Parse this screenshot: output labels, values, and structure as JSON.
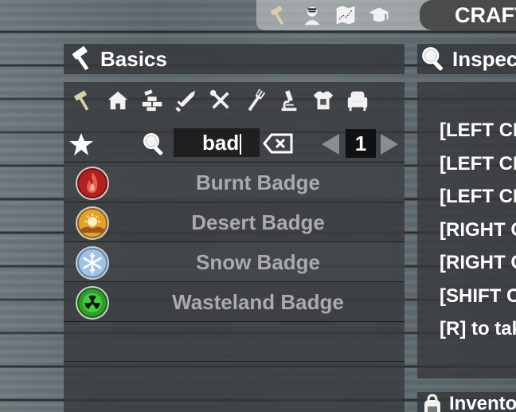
{
  "top_bar": {
    "icons": [
      "hammer-icon",
      "survivor-icon",
      "map-icon",
      "graduation-cap-icon"
    ],
    "title": "CRAFT"
  },
  "left_panel": {
    "title": "Basics",
    "categories": [
      "hammer-icon",
      "house-icon",
      "building-blocks-icon",
      "sword-icon",
      "tools-icon",
      "fork-icon",
      "microscope-icon",
      "armor-icon",
      "chair-icon"
    ],
    "search": {
      "value": "bad"
    },
    "page": "1",
    "items": [
      {
        "name": "Burnt Badge",
        "color": "#b22222"
      },
      {
        "name": "Desert Badge",
        "color": "#e3a22a"
      },
      {
        "name": "Snow Badge",
        "color": "#9fc3e4"
      },
      {
        "name": "Wasteland Badge",
        "color": "#2f9e2a"
      }
    ]
  },
  "right_panel": {
    "title": "Inspect",
    "instructions": [
      "[LEFT CLIC",
      "[LEFT CLIC",
      "[LEFT CLIC",
      "[RIGHT CL",
      "[RIGHT CL",
      "[SHIFT CL",
      "[R] to tak"
    ],
    "inventory_title": "Inventory"
  }
}
